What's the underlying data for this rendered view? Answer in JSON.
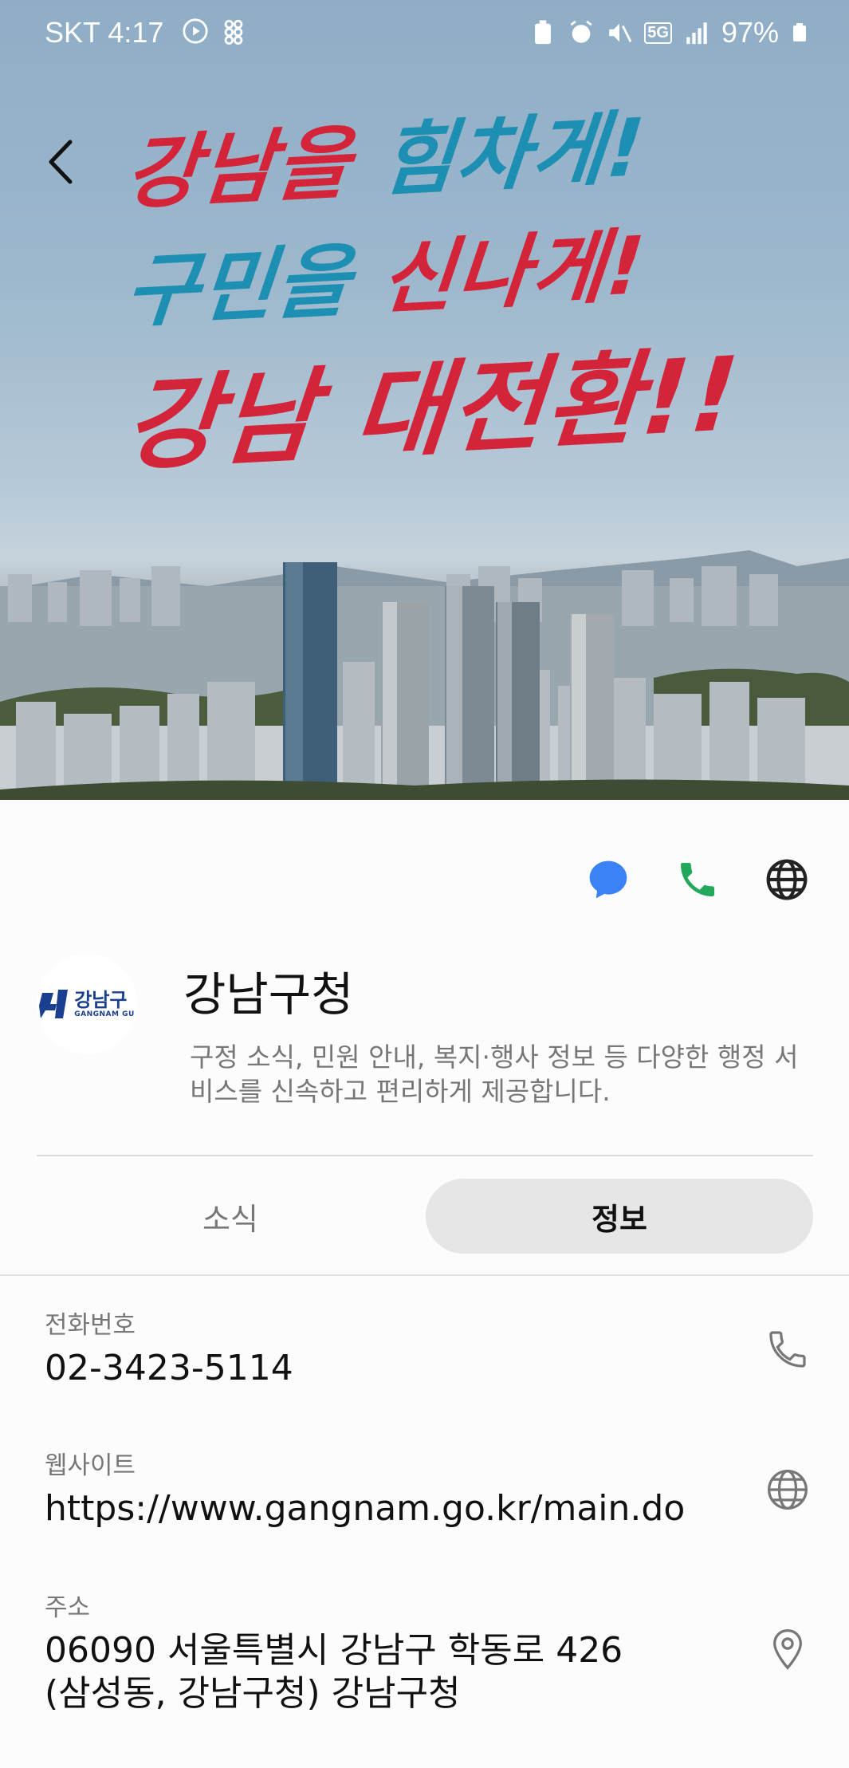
{
  "status_bar": {
    "carrier_time": "SKT 4:17",
    "network": "5G",
    "battery": "97%"
  },
  "hero": {
    "slogan_line1_a": "강남을 ",
    "slogan_line1_b": "힘차게!",
    "slogan_line2_a": "구민을 ",
    "slogan_line2_b": "신나게!",
    "slogan_line3": "강남 대전환!!"
  },
  "profile": {
    "logo_ko": "강남구",
    "logo_en": "GANGNAM GU",
    "name": "강남구청",
    "description": "구정 소식, 민원 안내, 복지·행사 정보 등 다양한 행정 서비스를 신속하고 편리하게 제공합니다."
  },
  "tabs": [
    {
      "label": "소식",
      "selected": false
    },
    {
      "label": "정보",
      "selected": true
    }
  ],
  "info": {
    "phone": {
      "label": "전화번호",
      "value": "02-3423-5114",
      "icon": "phone-icon"
    },
    "website": {
      "label": "웹사이트",
      "value": "https://www.gangnam.go.kr/main.do",
      "icon": "globe-icon"
    },
    "address": {
      "label": "주소",
      "line1": "06090 서울특별시 강남구 학동로 426",
      "line2": "(삼성동, 강남구청) 강남구청",
      "icon": "location-pin-icon"
    }
  },
  "colors": {
    "chat": "#3b82f6",
    "call": "#22a85a",
    "slogan_red": "#d3243a",
    "slogan_blue": "#1d8fb3",
    "logo_blue": "#1a3f91"
  }
}
